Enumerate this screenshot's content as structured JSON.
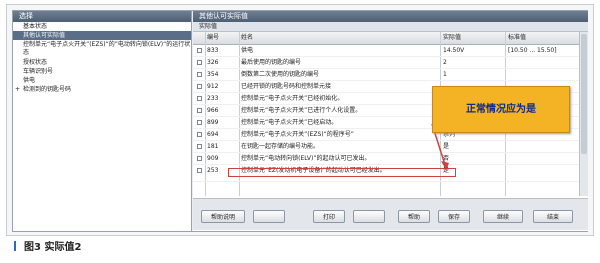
{
  "left_panel": {
    "header": "选择",
    "items": [
      {
        "label": "基本状态",
        "selected": false,
        "expander": ""
      },
      {
        "label": "其他认可实际值",
        "selected": true,
        "expander": ""
      },
      {
        "label": "控制单元“电子点火开关”(EZS)“的”电动转向锁(ELV)“的运行状态",
        "selected": false,
        "expander": ""
      },
      {
        "label": "授权状态",
        "selected": false,
        "expander": ""
      },
      {
        "label": "车辆识别号",
        "selected": false,
        "expander": ""
      },
      {
        "label": "供电",
        "selected": false,
        "expander": ""
      },
      {
        "label": "检测到的钥匙号码",
        "selected": false,
        "expander": "+"
      }
    ]
  },
  "right_panel": {
    "header": "其他认可实际值",
    "subheader": "实际值",
    "columns": {
      "id": "编号",
      "name": "姓名",
      "value": "实际值",
      "standard": "标准值"
    },
    "rows": [
      {
        "id": "833",
        "name": "供电",
        "value": "14.50V",
        "standard": "[10.50 ... 15.50]"
      },
      {
        "id": "326",
        "name": "最后使用的钥匙的编号",
        "value": "2",
        "standard": ""
      },
      {
        "id": "354",
        "name": "倒数第二次使用的钥匙的编号",
        "value": "1",
        "standard": ""
      },
      {
        "id": "912",
        "name": "已经开锁的钥匙号码和控制单元接",
        "value": "",
        "standard": ""
      },
      {
        "id": "233",
        "name": "控制单元“电子点火开关”已经初始化。",
        "value": "是",
        "standard": ""
      },
      {
        "id": "966",
        "name": "控制单元“电子点火开关”已进行个人化设置。",
        "value": "是",
        "standard": ""
      },
      {
        "id": "899",
        "name": "控制单元“电子点火开关”已经启动。",
        "value": "是",
        "standard": ""
      },
      {
        "id": "694",
        "name": "控制单元“电子点火开关”(EZS)“的程序号”",
        "value": "系列",
        "standard": ""
      },
      {
        "id": "181",
        "name": "在钥匙一起存储的编号功能。",
        "value": "是",
        "standard": ""
      },
      {
        "id": "909",
        "name": "控制单元“电动转向锁(ELV)”的起动认可已发出。",
        "value": "否",
        "standard": ""
      },
      {
        "id": "253",
        "name": "控制单元“EZ(发动机电子设备)”的起动认可已经发出。",
        "value": "是",
        "standard": ""
      }
    ]
  },
  "buttons": [
    "帮助说明",
    "",
    "打印",
    "",
    "帮助",
    "保存",
    "继续",
    "结束"
  ],
  "callout": {
    "text": "正常情况应为是",
    "color": "#f3b325",
    "text_color": "#0b2a8f"
  },
  "highlight_color": "#c9433f",
  "caption": "图3   实际值2"
}
